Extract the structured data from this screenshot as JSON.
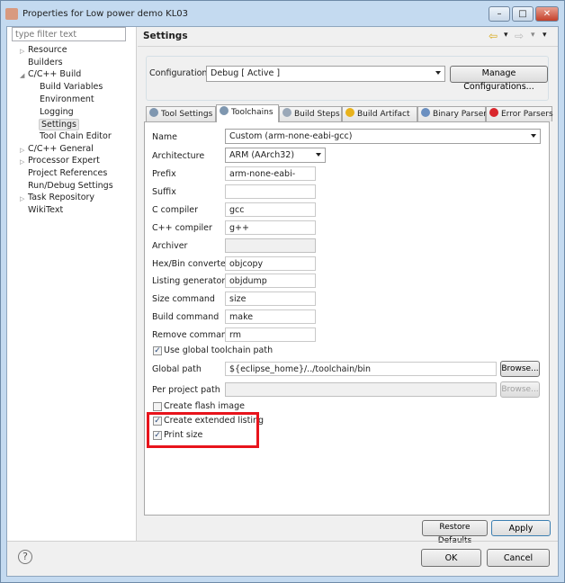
{
  "window": {
    "title": "Properties for Low power demo KL03",
    "minimize": "–",
    "maximize": "□",
    "close": "✕"
  },
  "sidebar": {
    "filter_placeholder": "type filter text",
    "items": [
      {
        "label": "Resource",
        "twisty": "▷",
        "level": 0
      },
      {
        "label": "Builders",
        "twisty": "",
        "level": 0
      },
      {
        "label": "C/C++ Build",
        "twisty": "◢",
        "level": 0
      },
      {
        "label": "Build Variables",
        "twisty": "",
        "level": 1
      },
      {
        "label": "Environment",
        "twisty": "",
        "level": 1
      },
      {
        "label": "Logging",
        "twisty": "",
        "level": 1
      },
      {
        "label": "Settings",
        "twisty": "",
        "level": 1,
        "selected": true
      },
      {
        "label": "Tool Chain Editor",
        "twisty": "",
        "level": 1
      },
      {
        "label": "C/C++ General",
        "twisty": "▷",
        "level": 0
      },
      {
        "label": "Processor Expert",
        "twisty": "▷",
        "level": 0
      },
      {
        "label": "Project References",
        "twisty": "",
        "level": 0
      },
      {
        "label": "Run/Debug Settings",
        "twisty": "",
        "level": 0
      },
      {
        "label": "Task Repository",
        "twisty": "▷",
        "level": 0
      },
      {
        "label": "WikiText",
        "twisty": "",
        "level": 0
      }
    ]
  },
  "header": {
    "title": "Settings",
    "nav": {
      "back": "⇦",
      "back_menu": "▾",
      "forward": "⇨",
      "forward_menu": "▾",
      "view_menu": "▾"
    }
  },
  "configuration": {
    "label": "Configuration:",
    "value": "Debug  [ Active ]",
    "manage_button": "Manage Configurations..."
  },
  "tabs": [
    {
      "label": "Tool Settings",
      "icon": "tool-settings-icon",
      "color": "#7f97b0"
    },
    {
      "label": "Toolchains",
      "icon": "toolchains-icon",
      "color": "#7f97b0",
      "active": true
    },
    {
      "label": "Build Steps",
      "icon": "build-steps-icon",
      "color": "#9aa8b8"
    },
    {
      "label": "Build Artifact",
      "icon": "build-artifact-icon",
      "color": "#e8b21c"
    },
    {
      "label": "Binary Parsers",
      "icon": "binary-parsers-icon",
      "color": "#6a8fc0"
    },
    {
      "label": "Error Parsers",
      "icon": "error-parsers-icon",
      "color": "#d9262c"
    }
  ],
  "toolchain": {
    "name": {
      "label": "Name",
      "value": "Custom (arm-none-eabi-gcc)"
    },
    "architecture": {
      "label": "Architecture",
      "value": "ARM (AArch32)"
    },
    "fields": [
      {
        "label": "Prefix",
        "value": "arm-none-eabi-"
      },
      {
        "label": "Suffix",
        "value": ""
      },
      {
        "label": "C compiler",
        "value": "gcc"
      },
      {
        "label": "C++ compiler",
        "value": "g++"
      },
      {
        "label": "Archiver",
        "value": "",
        "disabled": true
      },
      {
        "label": "Hex/Bin converter",
        "value": "objcopy"
      },
      {
        "label": "Listing generator",
        "value": "objdump"
      },
      {
        "label": "Size command",
        "value": "size"
      },
      {
        "label": "Build command",
        "value": "make"
      },
      {
        "label": "Remove command",
        "value": "rm"
      }
    ],
    "use_global_path": {
      "label": "Use global toolchain path",
      "checked": true
    },
    "global_path": {
      "label": "Global path",
      "value": "${eclipse_home}/../toolchain/bin",
      "browse": "Browse..."
    },
    "per_project_path": {
      "label": "Per project path",
      "value": "",
      "browse": "Browse..."
    },
    "create_flash_image": {
      "label": "Create flash image",
      "checked": false
    },
    "create_extended_listing": {
      "label": "Create extended listing",
      "checked": true
    },
    "print_size": {
      "label": "Print size",
      "checked": true
    },
    "highlight_color": "#e8141c"
  },
  "buttons": {
    "restore_defaults": "Restore Defaults",
    "apply": "Apply",
    "ok": "OK",
    "cancel": "Cancel",
    "help": "?"
  }
}
